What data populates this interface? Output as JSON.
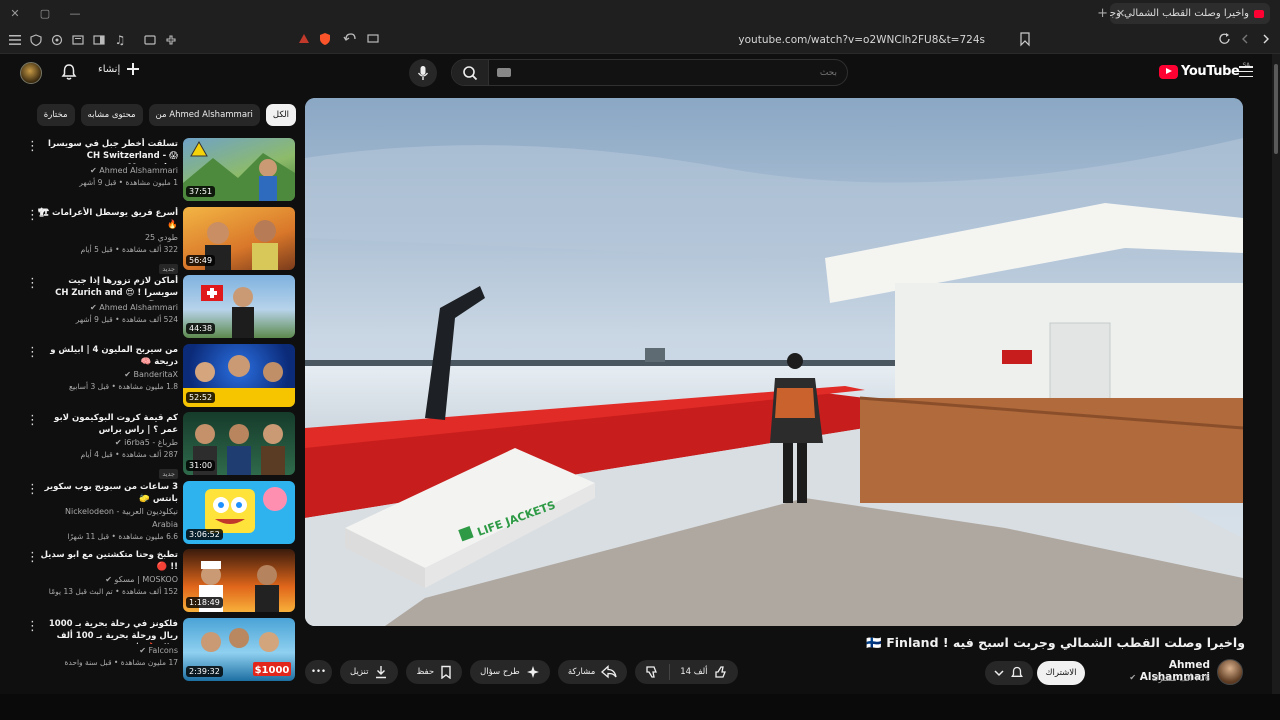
{
  "browser": {
    "tab_title": "واخيرا وصلت القطب الشمالي وجربت",
    "url": "youtube.com/watch?v=o2WNClh2FU8&t=724s",
    "win_controls": [
      "✕",
      "▢",
      "—"
    ],
    "new_tab": "+",
    "tab_close": "✕"
  },
  "header": {
    "create_label": "إنشاء",
    "search_placeholder": "بحث",
    "logo_text": "YouTube",
    "logo_region": "SA"
  },
  "chips": [
    {
      "label": "الكل",
      "active": true
    },
    {
      "label": "من Ahmed Alshammari",
      "active": false
    },
    {
      "label": "محتوى مشابه",
      "active": false
    },
    {
      "label": "مختارة",
      "active": false
    }
  ],
  "recommendations": [
    {
      "title": "تسلقت أخطر جبل في سويسرا 😱 - CH Switzerland Mountains",
      "channel": "Ahmed Alshammari",
      "verified": true,
      "stats": "1 مليون مشاهدة • قبل 9 أشهر",
      "duration": "37:51",
      "badge": ""
    },
    {
      "title": "أسرع فريق يوسطل الأعرامات 🏗 🔥",
      "channel": "طودي 25",
      "verified": false,
      "stats": "322 ألف مشاهدة • قبل 5 أيام",
      "duration": "56:49",
      "badge": "جديد"
    },
    {
      "title": "أماكن لازم تزورها إذا جيت سويسرا ! 😍 CH Zurich and Davos -",
      "channel": "Ahmed Alshammari",
      "verified": true,
      "stats": "524 ألف مشاهدة • قبل 9 أشهر",
      "duration": "44:38",
      "badge": ""
    },
    {
      "title": "من سيربح المليون 4 | ابيلش و دريحة 🧠",
      "channel": "BanderitaX",
      "verified": true,
      "stats": "1.8 مليون مشاهدة • قبل 3 أسابيع",
      "duration": "52:52",
      "badge": ""
    },
    {
      "title": "كم قيمة كروت البوكيمون لابو عمر ؟ | راس براس",
      "channel": "طرباغ - i6rba5",
      "verified": true,
      "stats": "287 ألف مشاهدة • قبل 4 أيام",
      "duration": "31:00",
      "badge": "جديد"
    },
    {
      "title": "3 ساعات من سبونج بوب سكوير بانتس 🧽",
      "channel": "نيكلوديون العربية - Nickelodeon Arabia",
      "verified": false,
      "stats": "6.6 مليون مشاهدة • قبل 11 شهرًا",
      "duration": "3:06:52",
      "badge": ""
    },
    {
      "title": "تطبخ وحنا متكشتين مع ابو سديل !! 🔴",
      "channel": "MOSKOO | مسكو",
      "verified": true,
      "stats": "152 ألف مشاهدة • تم البث قبل 13 يومًا",
      "duration": "1:18:49",
      "badge": ""
    },
    {
      "title": "فلكونز في رحلة بحرية بـ 1000 ريال ورحلة بحرية بـ 100 ألف ريال 🔥 🛳",
      "channel": "Falcons",
      "verified": true,
      "stats": "17 مليون مشاهدة • قبل سنة واحدة",
      "duration": "2:39:32",
      "badge": ""
    }
  ],
  "video": {
    "title": "واخيرا وصلت القطب الشمالي وجربت اسبح فيه ! 🇫🇮 Finland",
    "channel": "Ahmed Alshammari",
    "subscribers": "726 ألف مشترك",
    "subscribe_label": "الاشتراك",
    "scene_sign": "LIFE JACKETS",
    "actions": {
      "likes": "14 ألف",
      "share": "مشاركة",
      "ask": "طرح سؤال",
      "save": "حفظ",
      "download": "تنزيل",
      "more": "•••"
    }
  }
}
